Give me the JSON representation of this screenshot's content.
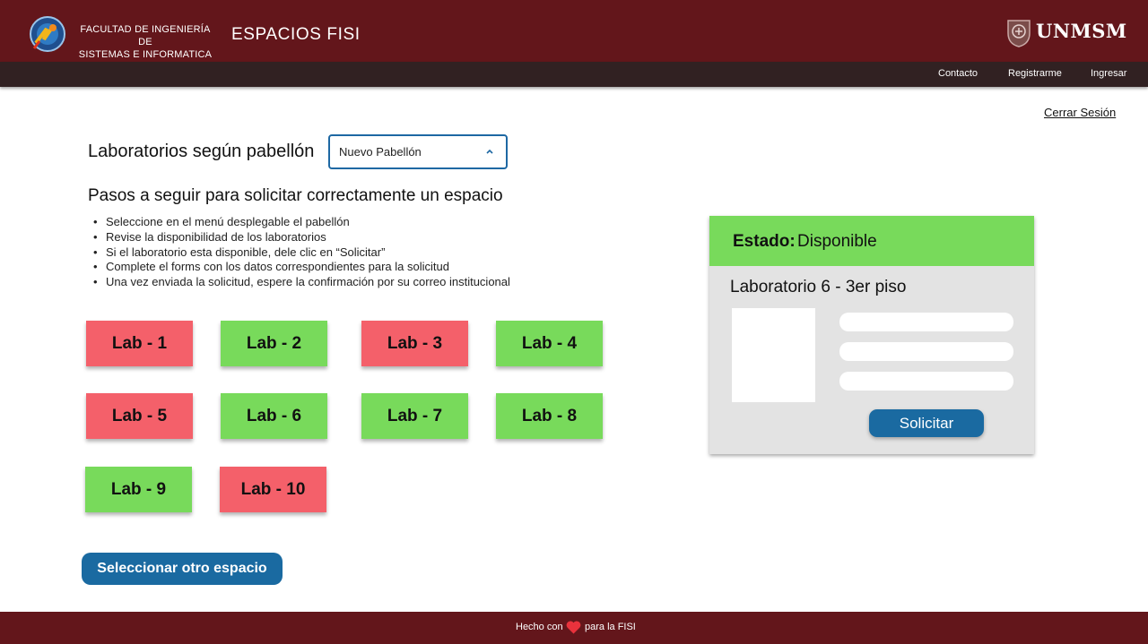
{
  "header": {
    "faculty_line1": "FACULTAD DE INGENIERÍA DE",
    "faculty_line2": "SISTEMAS E INFORMATICA",
    "site_title": "ESPACIOS FISI",
    "university": "UNMSM"
  },
  "nav": {
    "contact": "Contacto",
    "register": "Registrarme",
    "login": "Ingresar"
  },
  "logout": "Cerrar Sesión",
  "pavilion": {
    "label": "Laboratorios según pabellón",
    "selected": "Nuevo Pabellón"
  },
  "steps": {
    "title": "Pasos a seguir para solicitar correctamente un espacio",
    "items": [
      "Seleccione en el menú desplegable el pabellón",
      "Revise la disponibilidad de los laboratorios",
      "Si el laboratorio esta disponible, dele clic en “Solicitar”",
      "Complete el forms con los datos correspondientes para la solicitud",
      "Una vez enviada la solicitud, espere la confirmación por su correo institucional"
    ]
  },
  "labs": [
    {
      "label": "Lab - 1",
      "status": "occupied"
    },
    {
      "label": "Lab - 2",
      "status": "available"
    },
    {
      "label": "Lab - 3",
      "status": "occupied"
    },
    {
      "label": "Lab - 4",
      "status": "available"
    },
    {
      "label": "Lab - 5",
      "status": "occupied"
    },
    {
      "label": "Lab - 6",
      "status": "available"
    },
    {
      "label": "Lab - 7",
      "status": "available"
    },
    {
      "label": "Lab - 8",
      "status": "available"
    },
    {
      "label": "Lab - 9",
      "status": "available"
    },
    {
      "label": "Lab - 10",
      "status": "occupied"
    }
  ],
  "status_colors": {
    "available": "#78da5b",
    "occupied": "#f4606a"
  },
  "select_other": "Seleccionar otro espacio",
  "detail": {
    "status_key": "Estado:",
    "status_value": "Disponible",
    "title": "Laboratorio 6 - 3er piso",
    "request_button": "Solicitar"
  },
  "footer": {
    "prefix": "Hecho con",
    "heart_icon": "heart-icon",
    "suffix": "para la FISI"
  }
}
